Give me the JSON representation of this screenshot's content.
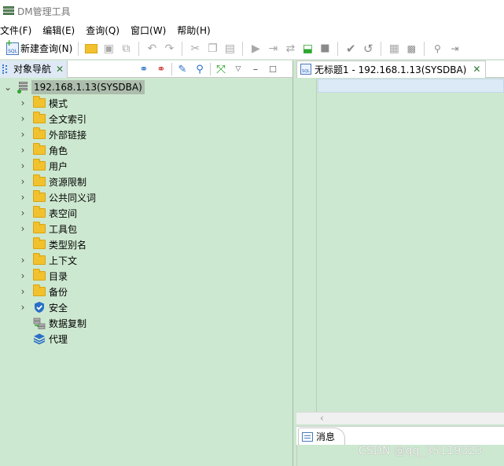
{
  "window": {
    "title": "DM管理工具"
  },
  "menubar": [
    "文件(F)",
    "编辑(E)",
    "查询(Q)",
    "窗口(W)",
    "帮助(H)"
  ],
  "toolbar": {
    "new_query_label": "新建查询(N)"
  },
  "navigator": {
    "tab_label": "对象导航",
    "root": "192.168.1.13(SYSDBA)",
    "items": [
      {
        "label": "模式",
        "icon": "folder-icon",
        "expandable": true
      },
      {
        "label": "全文索引",
        "icon": "folder-icon",
        "expandable": true
      },
      {
        "label": "外部链接",
        "icon": "folder-icon",
        "expandable": true
      },
      {
        "label": "角色",
        "icon": "folder-icon",
        "expandable": true
      },
      {
        "label": "用户",
        "icon": "folder-icon",
        "expandable": true
      },
      {
        "label": "资源限制",
        "icon": "folder-icon",
        "expandable": true
      },
      {
        "label": "公共同义词",
        "icon": "folder-icon",
        "expandable": true
      },
      {
        "label": "表空间",
        "icon": "folder-icon",
        "expandable": true
      },
      {
        "label": "工具包",
        "icon": "folder-icon",
        "expandable": true
      },
      {
        "label": "类型别名",
        "icon": "folder-icon",
        "expandable": false
      },
      {
        "label": "上下文",
        "icon": "folder-icon",
        "expandable": true
      },
      {
        "label": "目录",
        "icon": "folder-icon",
        "expandable": true
      },
      {
        "label": "备份",
        "icon": "folder-icon",
        "expandable": true
      },
      {
        "label": "安全",
        "icon": "shield-icon",
        "expandable": true
      },
      {
        "label": "数据复制",
        "icon": "replication-icon",
        "expandable": false
      },
      {
        "label": "代理",
        "icon": "layers-icon",
        "expandable": false
      }
    ]
  },
  "editor": {
    "tab_label": "无标题1 - 192.168.1.13(SYSDBA)"
  },
  "messages": {
    "tab_label": "消息"
  },
  "watermark": "CSDN @qq_35119323",
  "colors": {
    "background": "#cde8d0",
    "selection": "#adbdad",
    "folder": "#f2c12e"
  }
}
